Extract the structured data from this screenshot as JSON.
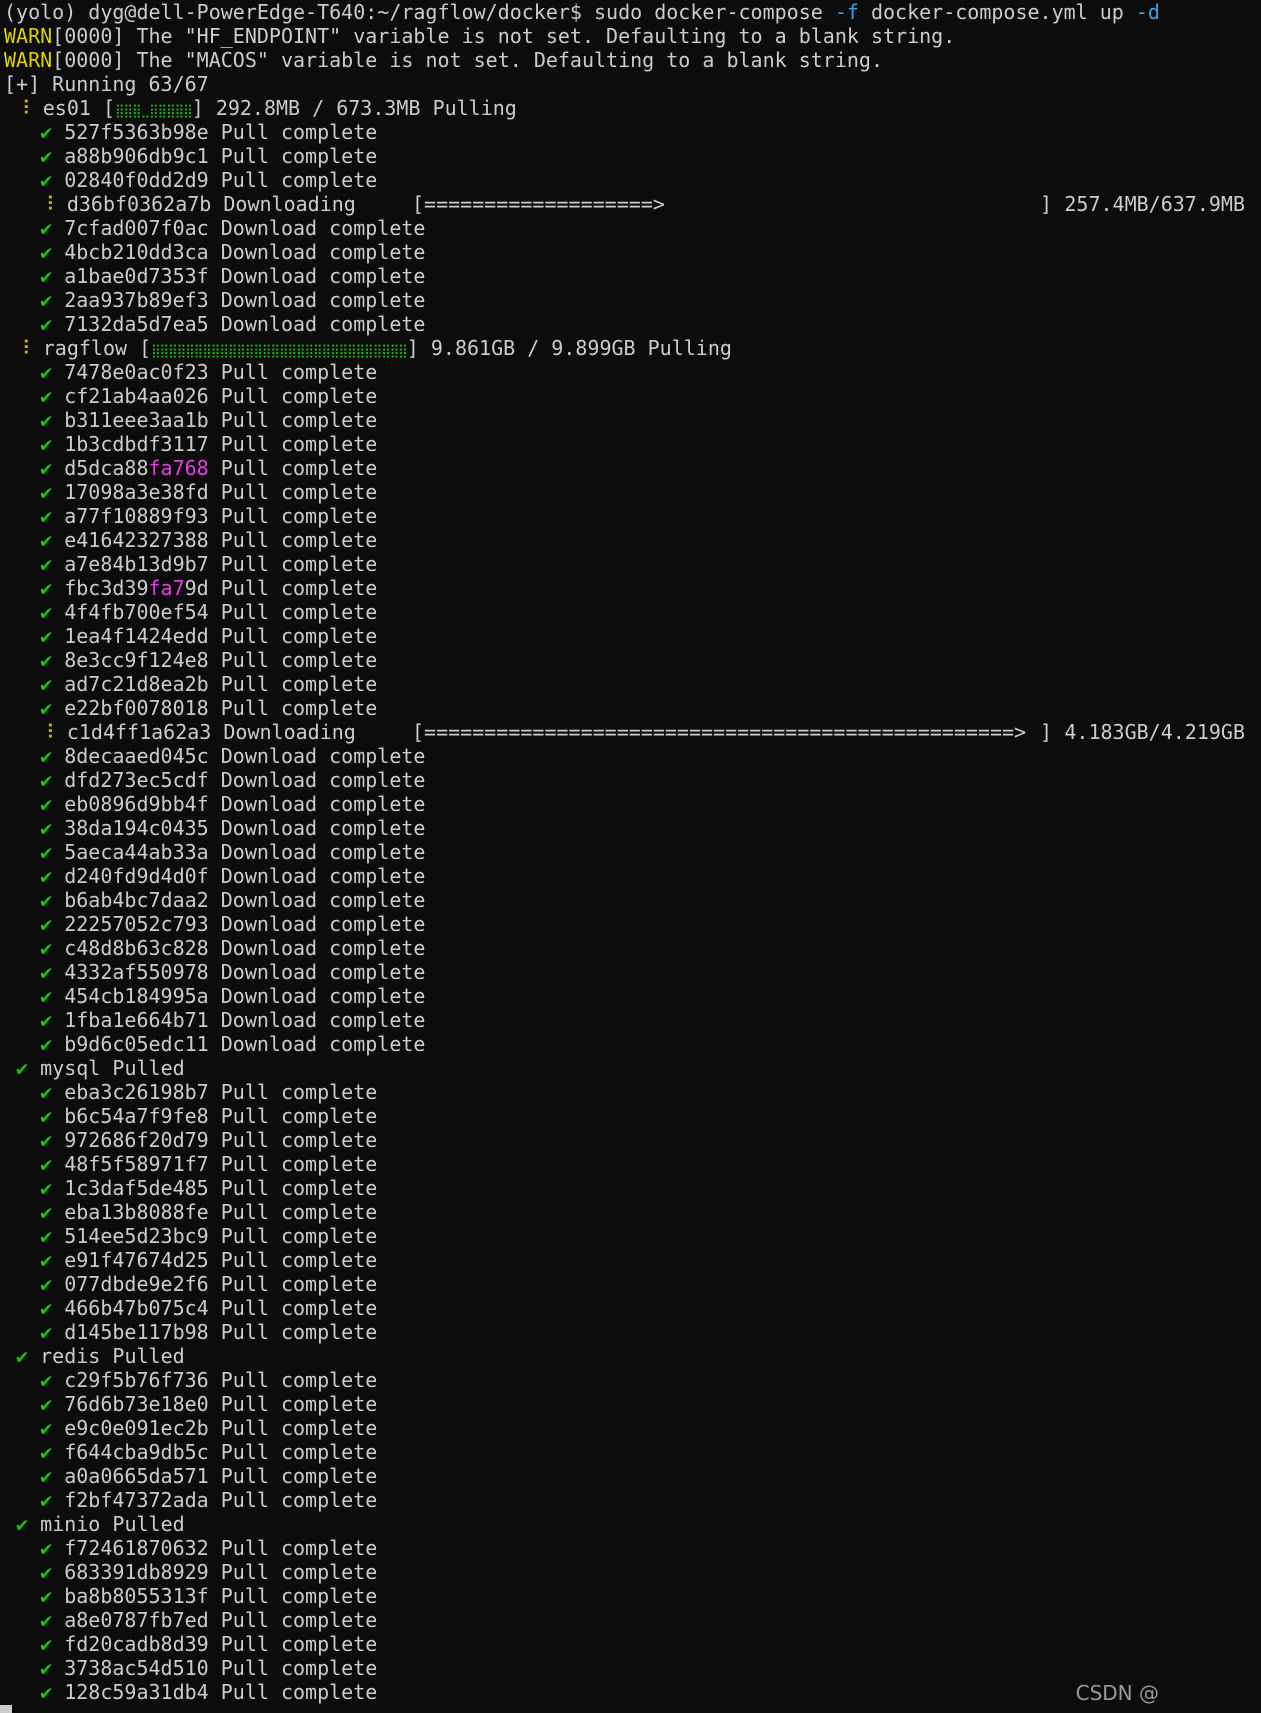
{
  "command": {
    "prompt": "(yolo) dyg@dell-PowerEdge-T640:~/ragflow/docker$ ",
    "cmd": "sudo docker-compose ",
    "flag_f": "-f",
    "file": " docker-compose.yml up ",
    "flag_d": "-d"
  },
  "warnings": [
    {
      "level": "WARN",
      "text": "[0000] The \"HF_ENDPOINT\" variable is not set. Defaulting to a blank string."
    },
    {
      "level": "WARN",
      "text": "[0000] The \"MACOS\" variable is not set. Defaulting to a blank string."
    }
  ],
  "running": "[+] Running 63/67",
  "services": [
    {
      "name": "es01",
      "status_icon": "⠸",
      "pulled": false,
      "bar": "⣿⣿⣿⣀⣿⣿⣿⣿⣿",
      "size": "292.8MB / 673.3MB",
      "status": "Pulling",
      "layers": [
        {
          "id": "527f5363b98e",
          "status": "Pull complete",
          "done": true
        },
        {
          "id": "a88b906db9c1",
          "status": "Pull complete",
          "done": true
        },
        {
          "id": "02840f0dd2d9",
          "status": "Pull complete",
          "done": true
        },
        {
          "id": "d36bf0362a7b",
          "status": "Downloading",
          "done": false,
          "progress_bar": "[===================>",
          "progress_end": "]",
          "size": "257.4MB/637.9MB"
        },
        {
          "id": "7cfad007f0ac",
          "status": "Download complete",
          "done": true
        },
        {
          "id": "4bcb210dd3ca",
          "status": "Download complete",
          "done": true
        },
        {
          "id": "a1bae0d7353f",
          "status": "Download complete",
          "done": true
        },
        {
          "id": "2aa937b89ef3",
          "status": "Download complete",
          "done": true
        },
        {
          "id": "7132da5d7ea5",
          "status": "Download complete",
          "done": true
        }
      ]
    },
    {
      "name": "ragflow",
      "status_icon": "⠸",
      "pulled": false,
      "bar": "⣿⣿⣿⣿⣿⣿⣿⣿⣿⣿⣿⣿⣿⣿⣿⣿⣿⣿⣿⣿⣿⣿⣿⣿⣿⣿⣿⣿⣿⣿",
      "size": "9.861GB / 9.899GB",
      "status": "Pulling",
      "layers": [
        {
          "id": "7478e0ac0f23",
          "status": "Pull complete",
          "done": true
        },
        {
          "id": "cf21ab4aa026",
          "status": "Pull complete",
          "done": true
        },
        {
          "id": "b311eee3aa1b",
          "status": "Pull complete",
          "done": true
        },
        {
          "id": "1b3cdbdf3117",
          "status": "Pull complete",
          "done": true
        },
        {
          "id": "d5dca88fa768",
          "id_pre": "d5dca88",
          "id_hl": "fa768",
          "id_post": "",
          "status": "Pull complete",
          "done": true
        },
        {
          "id": "17098a3e38fd",
          "status": "Pull complete",
          "done": true
        },
        {
          "id": "a77f10889f93",
          "status": "Pull complete",
          "done": true
        },
        {
          "id": "e41642327388",
          "status": "Pull complete",
          "done": true
        },
        {
          "id": "a7e84b13d9b7",
          "status": "Pull complete",
          "done": true
        },
        {
          "id": "fbc3d39fa79d",
          "id_pre": "fbc3d39",
          "id_hl": "fa7",
          "id_post": "9d",
          "status": "Pull complete",
          "done": true
        },
        {
          "id": "4f4fb700ef54",
          "status": "Pull complete",
          "done": true
        },
        {
          "id": "1ea4f1424edd",
          "status": "Pull complete",
          "done": true
        },
        {
          "id": "8e3cc9f124e8",
          "status": "Pull complete",
          "done": true
        },
        {
          "id": "ad7c21d8ea2b",
          "status": "Pull complete",
          "done": true
        },
        {
          "id": "e22bf0078018",
          "status": "Pull complete",
          "done": true
        },
        {
          "id": "c1d4ff1a62a3",
          "status": "Downloading",
          "done": false,
          "progress_bar": "[=================================================>",
          "progress_end": "]",
          "size": "4.183GB/4.219GB"
        },
        {
          "id": "8decaaed045c",
          "status": "Download complete",
          "done": true
        },
        {
          "id": "dfd273ec5cdf",
          "status": "Download complete",
          "done": true
        },
        {
          "id": "eb0896d9bb4f",
          "status": "Download complete",
          "done": true
        },
        {
          "id": "38da194c0435",
          "status": "Download complete",
          "done": true
        },
        {
          "id": "5aeca44ab33a",
          "status": "Download complete",
          "done": true
        },
        {
          "id": "d240fd9d4d0f",
          "status": "Download complete",
          "done": true
        },
        {
          "id": "b6ab4bc7daa2",
          "status": "Download complete",
          "done": true
        },
        {
          "id": "22257052c793",
          "status": "Download complete",
          "done": true
        },
        {
          "id": "c48d8b63c828",
          "status": "Download complete",
          "done": true
        },
        {
          "id": "4332af550978",
          "status": "Download complete",
          "done": true
        },
        {
          "id": "454cb184995a",
          "status": "Download complete",
          "done": true
        },
        {
          "id": "1fba1e664b71",
          "status": "Download complete",
          "done": true
        },
        {
          "id": "b9d6c05edc11",
          "status": "Download complete",
          "done": true
        }
      ]
    },
    {
      "name": "mysql",
      "status_icon": "✔",
      "pulled": true,
      "status": "Pulled",
      "layers": [
        {
          "id": "eba3c26198b7",
          "status": "Pull complete",
          "done": true
        },
        {
          "id": "b6c54a7f9fe8",
          "status": "Pull complete",
          "done": true
        },
        {
          "id": "972686f20d79",
          "status": "Pull complete",
          "done": true
        },
        {
          "id": "48f5f58971f7",
          "status": "Pull complete",
          "done": true
        },
        {
          "id": "1c3daf5de485",
          "status": "Pull complete",
          "done": true
        },
        {
          "id": "eba13b8088fe",
          "status": "Pull complete",
          "done": true
        },
        {
          "id": "514ee5d23bc9",
          "status": "Pull complete",
          "done": true
        },
        {
          "id": "e91f47674d25",
          "status": "Pull complete",
          "done": true
        },
        {
          "id": "077dbde9e2f6",
          "status": "Pull complete",
          "done": true
        },
        {
          "id": "466b47b075c4",
          "status": "Pull complete",
          "done": true
        },
        {
          "id": "d145be117b98",
          "status": "Pull complete",
          "done": true
        }
      ]
    },
    {
      "name": "redis",
      "status_icon": "✔",
      "pulled": true,
      "status": "Pulled",
      "layers": [
        {
          "id": "c29f5b76f736",
          "status": "Pull complete",
          "done": true
        },
        {
          "id": "76d6b73e18e0",
          "status": "Pull complete",
          "done": true
        },
        {
          "id": "e9c0e091ec2b",
          "status": "Pull complete",
          "done": true
        },
        {
          "id": "f644cba9db5c",
          "status": "Pull complete",
          "done": true
        },
        {
          "id": "a0a0665da571",
          "status": "Pull complete",
          "done": true
        },
        {
          "id": "f2bf47372ada",
          "status": "Pull complete",
          "done": true
        }
      ]
    },
    {
      "name": "minio",
      "status_icon": "✔",
      "pulled": true,
      "status": "Pulled",
      "layers": [
        {
          "id": "f72461870632",
          "status": "Pull complete",
          "done": true
        },
        {
          "id": "683391db8929",
          "status": "Pull complete",
          "done": true
        },
        {
          "id": "ba8b8055313f",
          "status": "Pull complete",
          "done": true
        },
        {
          "id": "a8e0787fb7ed",
          "status": "Pull complete",
          "done": true
        },
        {
          "id": "fd20cadb8d39",
          "status": "Pull complete",
          "done": true
        },
        {
          "id": "3738ac54d510",
          "status": "Pull complete",
          "done": true
        },
        {
          "id": "128c59a31db4",
          "status": "Pull complete",
          "done": true
        }
      ]
    }
  ],
  "layer_done_icon": "✔",
  "layer_pending_icon": "⠸",
  "watermark": "CSDN @",
  "colors": {
    "background": "#0c0c0c",
    "text": "#cccccc",
    "ok": "#16c60c",
    "warn": "#dcd000",
    "param": "#3aa0e0",
    "highlight": "#e040e0"
  }
}
